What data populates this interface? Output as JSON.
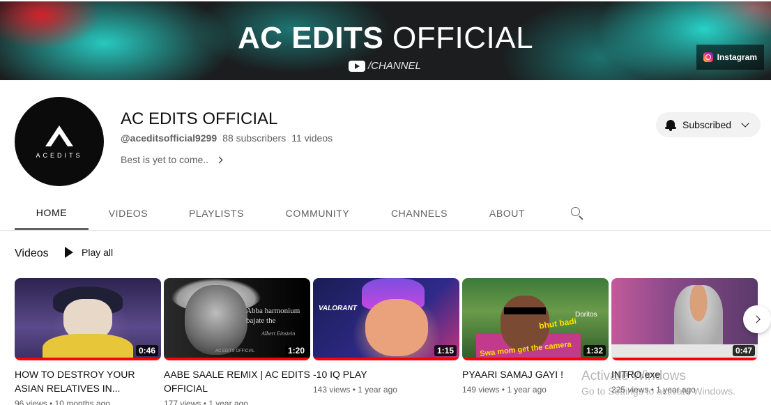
{
  "banner": {
    "title_bold": "AC EDITS",
    "title_light": "OFFICIAL",
    "channel_label": "/CHANNEL",
    "instagram_label": "Instagram"
  },
  "channel": {
    "avatar_text": "ACEDITS",
    "name": "AC EDITS OFFICIAL",
    "handle": "@aceditsofficial9299",
    "subscribers": "88 subscribers",
    "videos": "11 videos",
    "tagline": "Best is yet to come..",
    "subscribe_label": "Subscribed"
  },
  "tabs": [
    "HOME",
    "VIDEOS",
    "PLAYLISTS",
    "COMMUNITY",
    "CHANNELS",
    "ABOUT"
  ],
  "active_tab": "HOME",
  "section": {
    "title": "Videos",
    "play_all": "Play all"
  },
  "videos": [
    {
      "title": "HOW TO DESTROY YOUR ASIAN RELATIVES IN...",
      "duration": "0:46",
      "meta": "96 views • 10 months ago"
    },
    {
      "title": "AABE SAALE REMIX | AC EDITS OFFICIAL",
      "duration": "1:20",
      "meta": "177 views • 1 year ago",
      "caption": "Abba harmonium bajate the",
      "signature": "Albert Einstein",
      "watermark": "AC EDITS OFFICIAL"
    },
    {
      "title": "-10 IQ PLAY",
      "duration": "1:15",
      "meta": "143 views • 1 year ago",
      "logo": "VALORANT"
    },
    {
      "title": "PYAARI SAMAJ GAYI !",
      "duration": "1:32",
      "meta": "149 views • 1 year ago",
      "overlay1": "bhut badi",
      "overlay2": "Swa mom get the camera",
      "brand": "Doritos"
    },
    {
      "title": "INTRO.exe",
      "duration": "0:47",
      "meta": "225 views • 1 year ago"
    }
  ],
  "windows_watermark": {
    "line1": "Activate Windows",
    "line2": "Go to Settings to activate Windows."
  },
  "colors": {
    "progress": "#ff0000",
    "text_secondary": "#606060",
    "button_bg": "#f2f2f2"
  }
}
